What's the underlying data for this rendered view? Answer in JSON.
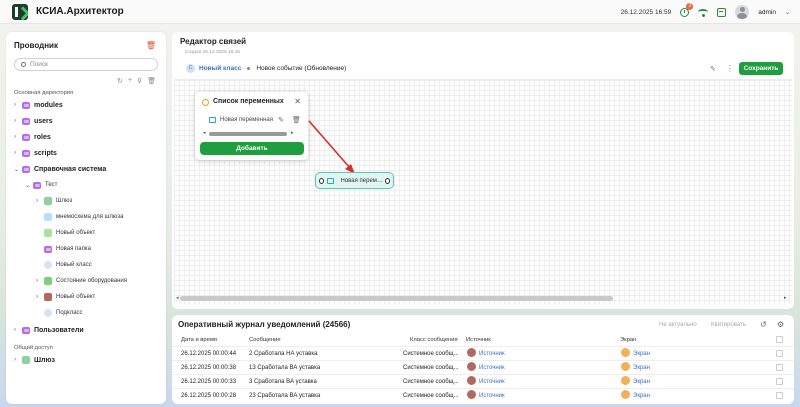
{
  "app": {
    "title": "КСИА.Архитектор"
  },
  "header": {
    "datetime": "26.12.2025 16:59",
    "notif_count": "3",
    "user": "admin"
  },
  "sidebar": {
    "title": "Проводник",
    "search_placeholder": "Поиск",
    "section_main": "Основная директория",
    "section_shared": "Общий доступ",
    "items": [
      {
        "label": "modules"
      },
      {
        "label": "users"
      },
      {
        "label": "roles"
      },
      {
        "label": "scripts"
      },
      {
        "label": "Справочная система"
      },
      {
        "label": "Тест"
      },
      {
        "label": "Шлюз"
      },
      {
        "label": "мнемосхема для шлюза"
      },
      {
        "label": "Новый объект"
      },
      {
        "label": "Новая папка"
      },
      {
        "label": "Новый класс"
      },
      {
        "label": "Состояние оборудования"
      },
      {
        "label": "Новый объект"
      },
      {
        "label": "Подкласс"
      },
      {
        "label": "Пользователи"
      },
      {
        "label": "Шлюз"
      }
    ]
  },
  "editor": {
    "title": "Редактор связей",
    "created": "Создан 26.12.2025 15:15",
    "crumb_link": "Новый класс",
    "crumb_event": "Новое событие (Обновление)",
    "save_label": "Сохранить",
    "class_icon_letter": "С"
  },
  "popup": {
    "title": "Список переменных",
    "item": "Новая переменная",
    "add_label": "Добавить"
  },
  "node": {
    "label": "Новая переменная"
  },
  "journal": {
    "title": "Оперативный журнал уведомлений (24566)",
    "btn_not_actual": "Не актуально",
    "btn_ack": "Квитировать",
    "columns": {
      "datetime": "Дата и время",
      "message": "Сообщение",
      "msg_class": "Класс сообщения",
      "source": "Источник",
      "screen": "Экран"
    },
    "rows": [
      {
        "datetime": "26.12.2025 00:00:44",
        "message": "2 Сработала НА уставка",
        "msg_class": "Системное сообщ...",
        "source": "Источник",
        "screen": "Экран"
      },
      {
        "datetime": "26.12.2025 00:00:38",
        "message": "13 Сработала ВА уставка",
        "msg_class": "Системное сообщ...",
        "source": "Источник",
        "screen": "Экран"
      },
      {
        "datetime": "26.12.2025 00:00:33",
        "message": "3 Сработала ВА уставка",
        "msg_class": "Системное сообщ...",
        "source": "Источник",
        "screen": "Экран"
      },
      {
        "datetime": "26.12.2025 00:00:28",
        "message": "23 Сработала ВА уставка",
        "msg_class": "Системное сообщ...",
        "source": "Источник",
        "screen": "Экран"
      }
    ]
  },
  "colors": {
    "accent": "#1e9e3e",
    "link": "#3a6fc4",
    "arrow": "#d32f2f",
    "node_border": "#57c7b6"
  }
}
